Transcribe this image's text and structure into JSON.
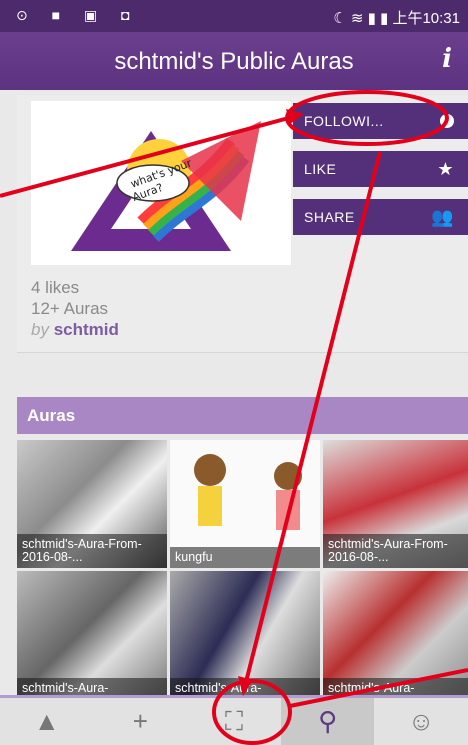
{
  "status": {
    "left_icons": "⊙ ■ ▣ ◘",
    "right_text": "☾ ≋ ▮ ▮ 上午10:31"
  },
  "header": {
    "title": "schtmid's Public Auras",
    "info_glyph": "i"
  },
  "card": {
    "likes": "4 likes",
    "auras": "12+ Auras",
    "by_prefix": "by ",
    "by_user": "schtmid",
    "buttons": {
      "follow": "FOLLOWI...",
      "like": "LIKE",
      "share": "SHARE"
    }
  },
  "section_title": "Auras",
  "tiles": [
    {
      "label": "schtmid's-Aura-From-2016-08-..."
    },
    {
      "label": "kungfu"
    },
    {
      "label": "schtmid's-Aura-From-2016-08-..."
    },
    {
      "label": "schtmid's-Aura-"
    },
    {
      "label": "schtmid's-Aura-"
    },
    {
      "label": "schtmid's-Aura-"
    }
  ],
  "nav": {
    "home": "▲",
    "add": "+",
    "scan": "⛶",
    "search": "⚲",
    "profile": "☺"
  },
  "colors": {
    "accent": "#5c3380",
    "annotation": "#e3001b",
    "section": "#a987c4"
  }
}
